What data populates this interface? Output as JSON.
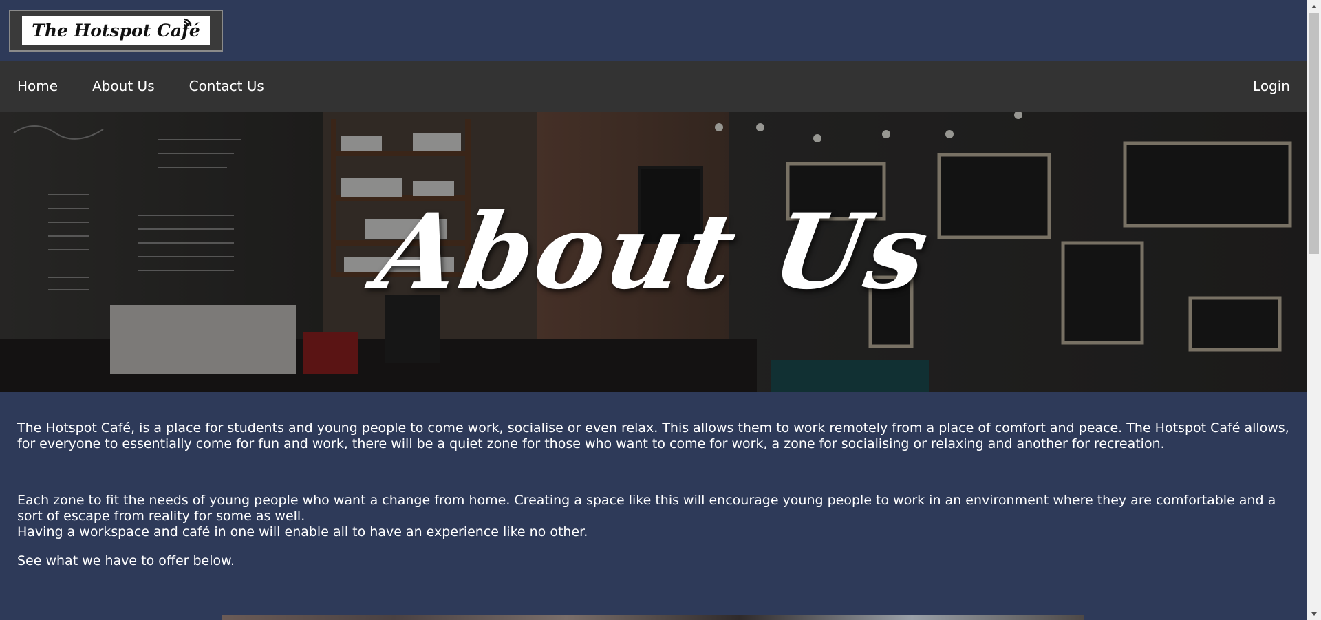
{
  "logo": {
    "text": "The Hotspot Café"
  },
  "nav": {
    "items": [
      "Home",
      "About Us",
      "Contact Us"
    ],
    "login": "Login"
  },
  "hero": {
    "title": "About Us"
  },
  "content": {
    "paragraph1": "The Hotspot Café, is a place for students and young people to come work, socialise or even relax. This allows them to work remotely from a place of comfort and peace. The Hotspot Café allows, for everyone to essentially come for fun and work, there will be a quiet zone for those who want to come for work, a zone for socialising or relaxing and another for recreation.",
    "paragraph2": "Each zone to fit the needs of young people who want a change from home. Creating a space like this will encourage young people to work in an environment where they are comfortable and a sort of escape from reality for some as well.",
    "paragraph3": "Having a workspace and café in one will enable all to have an experience like no other.",
    "paragraph4": "See what we have to offer below."
  },
  "colors": {
    "background": "#2e3a59",
    "nav": "#333333"
  }
}
